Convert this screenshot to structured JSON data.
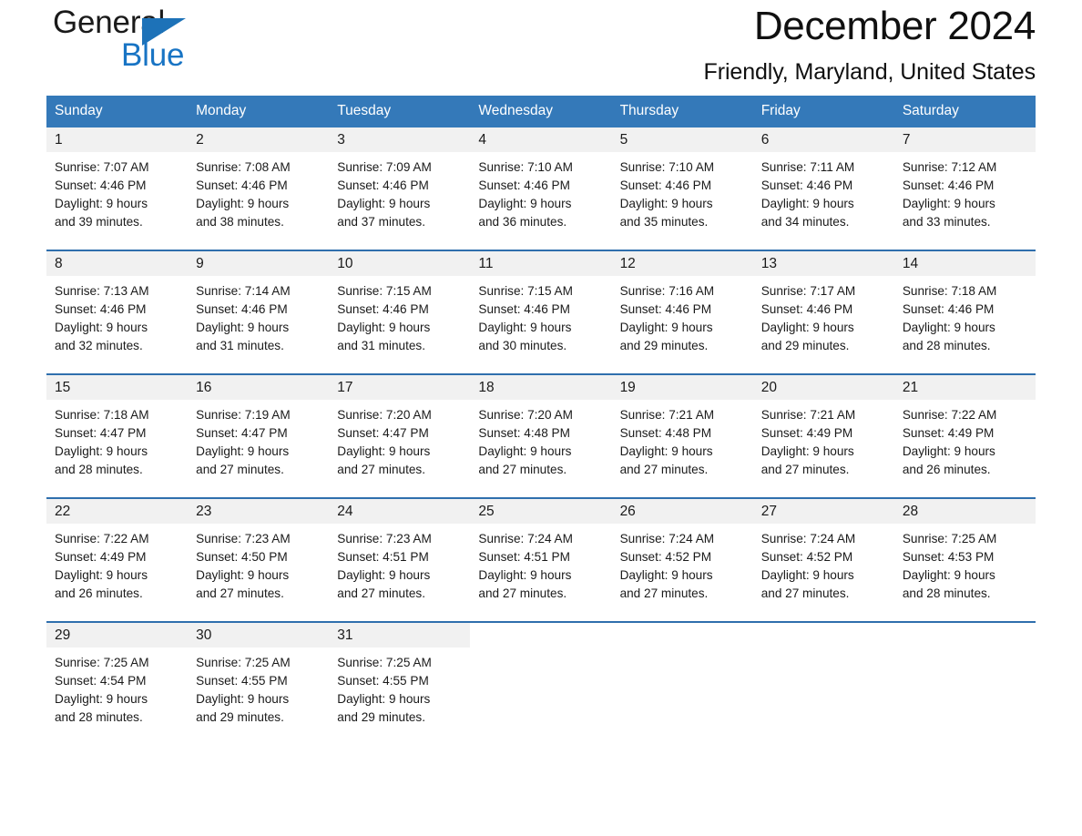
{
  "brand": {
    "name_part1": "General",
    "name_part2": "Blue",
    "logo_icon": "triangle-flag-icon",
    "blue": "#1874c4"
  },
  "header": {
    "title": "December 2024",
    "location": "Friendly, Maryland, United States"
  },
  "theme": {
    "header_blue": "#3479b9",
    "separator_blue": "#2f6fad",
    "daynum_band": "#f1f1f1"
  },
  "calendar": {
    "weekday_headers": [
      "Sunday",
      "Monday",
      "Tuesday",
      "Wednesday",
      "Thursday",
      "Friday",
      "Saturday"
    ],
    "weeks": [
      [
        {
          "day": "1",
          "sunrise": "Sunrise: 7:07 AM",
          "sunset": "Sunset: 4:46 PM",
          "daylight_line1": "Daylight: 9 hours",
          "daylight_line2": "and 39 minutes."
        },
        {
          "day": "2",
          "sunrise": "Sunrise: 7:08 AM",
          "sunset": "Sunset: 4:46 PM",
          "daylight_line1": "Daylight: 9 hours",
          "daylight_line2": "and 38 minutes."
        },
        {
          "day": "3",
          "sunrise": "Sunrise: 7:09 AM",
          "sunset": "Sunset: 4:46 PM",
          "daylight_line1": "Daylight: 9 hours",
          "daylight_line2": "and 37 minutes."
        },
        {
          "day": "4",
          "sunrise": "Sunrise: 7:10 AM",
          "sunset": "Sunset: 4:46 PM",
          "daylight_line1": "Daylight: 9 hours",
          "daylight_line2": "and 36 minutes."
        },
        {
          "day": "5",
          "sunrise": "Sunrise: 7:10 AM",
          "sunset": "Sunset: 4:46 PM",
          "daylight_line1": "Daylight: 9 hours",
          "daylight_line2": "and 35 minutes."
        },
        {
          "day": "6",
          "sunrise": "Sunrise: 7:11 AM",
          "sunset": "Sunset: 4:46 PM",
          "daylight_line1": "Daylight: 9 hours",
          "daylight_line2": "and 34 minutes."
        },
        {
          "day": "7",
          "sunrise": "Sunrise: 7:12 AM",
          "sunset": "Sunset: 4:46 PM",
          "daylight_line1": "Daylight: 9 hours",
          "daylight_line2": "and 33 minutes."
        }
      ],
      [
        {
          "day": "8",
          "sunrise": "Sunrise: 7:13 AM",
          "sunset": "Sunset: 4:46 PM",
          "daylight_line1": "Daylight: 9 hours",
          "daylight_line2": "and 32 minutes."
        },
        {
          "day": "9",
          "sunrise": "Sunrise: 7:14 AM",
          "sunset": "Sunset: 4:46 PM",
          "daylight_line1": "Daylight: 9 hours",
          "daylight_line2": "and 31 minutes."
        },
        {
          "day": "10",
          "sunrise": "Sunrise: 7:15 AM",
          "sunset": "Sunset: 4:46 PM",
          "daylight_line1": "Daylight: 9 hours",
          "daylight_line2": "and 31 minutes."
        },
        {
          "day": "11",
          "sunrise": "Sunrise: 7:15 AM",
          "sunset": "Sunset: 4:46 PM",
          "daylight_line1": "Daylight: 9 hours",
          "daylight_line2": "and 30 minutes."
        },
        {
          "day": "12",
          "sunrise": "Sunrise: 7:16 AM",
          "sunset": "Sunset: 4:46 PM",
          "daylight_line1": "Daylight: 9 hours",
          "daylight_line2": "and 29 minutes."
        },
        {
          "day": "13",
          "sunrise": "Sunrise: 7:17 AM",
          "sunset": "Sunset: 4:46 PM",
          "daylight_line1": "Daylight: 9 hours",
          "daylight_line2": "and 29 minutes."
        },
        {
          "day": "14",
          "sunrise": "Sunrise: 7:18 AM",
          "sunset": "Sunset: 4:46 PM",
          "daylight_line1": "Daylight: 9 hours",
          "daylight_line2": "and 28 minutes."
        }
      ],
      [
        {
          "day": "15",
          "sunrise": "Sunrise: 7:18 AM",
          "sunset": "Sunset: 4:47 PM",
          "daylight_line1": "Daylight: 9 hours",
          "daylight_line2": "and 28 minutes."
        },
        {
          "day": "16",
          "sunrise": "Sunrise: 7:19 AM",
          "sunset": "Sunset: 4:47 PM",
          "daylight_line1": "Daylight: 9 hours",
          "daylight_line2": "and 27 minutes."
        },
        {
          "day": "17",
          "sunrise": "Sunrise: 7:20 AM",
          "sunset": "Sunset: 4:47 PM",
          "daylight_line1": "Daylight: 9 hours",
          "daylight_line2": "and 27 minutes."
        },
        {
          "day": "18",
          "sunrise": "Sunrise: 7:20 AM",
          "sunset": "Sunset: 4:48 PM",
          "daylight_line1": "Daylight: 9 hours",
          "daylight_line2": "and 27 minutes."
        },
        {
          "day": "19",
          "sunrise": "Sunrise: 7:21 AM",
          "sunset": "Sunset: 4:48 PM",
          "daylight_line1": "Daylight: 9 hours",
          "daylight_line2": "and 27 minutes."
        },
        {
          "day": "20",
          "sunrise": "Sunrise: 7:21 AM",
          "sunset": "Sunset: 4:49 PM",
          "daylight_line1": "Daylight: 9 hours",
          "daylight_line2": "and 27 minutes."
        },
        {
          "day": "21",
          "sunrise": "Sunrise: 7:22 AM",
          "sunset": "Sunset: 4:49 PM",
          "daylight_line1": "Daylight: 9 hours",
          "daylight_line2": "and 26 minutes."
        }
      ],
      [
        {
          "day": "22",
          "sunrise": "Sunrise: 7:22 AM",
          "sunset": "Sunset: 4:49 PM",
          "daylight_line1": "Daylight: 9 hours",
          "daylight_line2": "and 26 minutes."
        },
        {
          "day": "23",
          "sunrise": "Sunrise: 7:23 AM",
          "sunset": "Sunset: 4:50 PM",
          "daylight_line1": "Daylight: 9 hours",
          "daylight_line2": "and 27 minutes."
        },
        {
          "day": "24",
          "sunrise": "Sunrise: 7:23 AM",
          "sunset": "Sunset: 4:51 PM",
          "daylight_line1": "Daylight: 9 hours",
          "daylight_line2": "and 27 minutes."
        },
        {
          "day": "25",
          "sunrise": "Sunrise: 7:24 AM",
          "sunset": "Sunset: 4:51 PM",
          "daylight_line1": "Daylight: 9 hours",
          "daylight_line2": "and 27 minutes."
        },
        {
          "day": "26",
          "sunrise": "Sunrise: 7:24 AM",
          "sunset": "Sunset: 4:52 PM",
          "daylight_line1": "Daylight: 9 hours",
          "daylight_line2": "and 27 minutes."
        },
        {
          "day": "27",
          "sunrise": "Sunrise: 7:24 AM",
          "sunset": "Sunset: 4:52 PM",
          "daylight_line1": "Daylight: 9 hours",
          "daylight_line2": "and 27 minutes."
        },
        {
          "day": "28",
          "sunrise": "Sunrise: 7:25 AM",
          "sunset": "Sunset: 4:53 PM",
          "daylight_line1": "Daylight: 9 hours",
          "daylight_line2": "and 28 minutes."
        }
      ],
      [
        {
          "day": "29",
          "sunrise": "Sunrise: 7:25 AM",
          "sunset": "Sunset: 4:54 PM",
          "daylight_line1": "Daylight: 9 hours",
          "daylight_line2": "and 28 minutes."
        },
        {
          "day": "30",
          "sunrise": "Sunrise: 7:25 AM",
          "sunset": "Sunset: 4:55 PM",
          "daylight_line1": "Daylight: 9 hours",
          "daylight_line2": "and 29 minutes."
        },
        {
          "day": "31",
          "sunrise": "Sunrise: 7:25 AM",
          "sunset": "Sunset: 4:55 PM",
          "daylight_line1": "Daylight: 9 hours",
          "daylight_line2": "and 29 minutes."
        },
        {
          "day": "",
          "sunrise": "",
          "sunset": "",
          "daylight_line1": "",
          "daylight_line2": ""
        },
        {
          "day": "",
          "sunrise": "",
          "sunset": "",
          "daylight_line1": "",
          "daylight_line2": ""
        },
        {
          "day": "",
          "sunrise": "",
          "sunset": "",
          "daylight_line1": "",
          "daylight_line2": ""
        },
        {
          "day": "",
          "sunrise": "",
          "sunset": "",
          "daylight_line1": "",
          "daylight_line2": ""
        }
      ]
    ]
  }
}
